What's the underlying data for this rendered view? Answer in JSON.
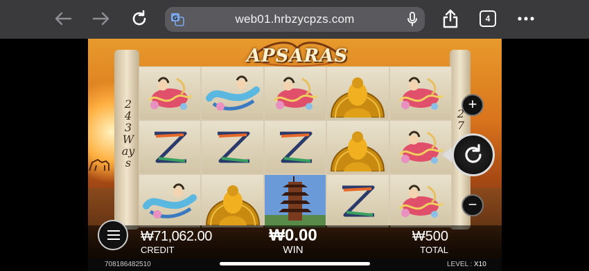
{
  "browser": {
    "url": "web01.hrbzycpzs.com",
    "tab_count": "4",
    "colors": {
      "toolbar": "#3a3a3c",
      "address_bar": "#5a5a5e",
      "icon": "#ffffff",
      "icon_disabled": "#8e8e93"
    }
  },
  "game": {
    "logo": "APSARAS",
    "ways_text": "243 Ways",
    "symbols": [
      [
        "apsara",
        "z-symbol",
        "apsara-2"
      ],
      [
        "apsara-2",
        "z-symbol",
        "buddha"
      ],
      [
        "apsara",
        "z-symbol",
        "pagoda"
      ],
      [
        "buddha",
        "buddha",
        "z-symbol"
      ],
      [
        "apsara",
        "apsara",
        "apsara"
      ]
    ],
    "credit": {
      "value": "₩71,062.00",
      "label": "CREDIT"
    },
    "win": {
      "value": "₩0.00",
      "label": "WIN"
    },
    "total": {
      "value": "₩500",
      "label": "TOTAL"
    },
    "session_id": "708186482510",
    "level": {
      "label": "LEVEL :",
      "value": "X10"
    }
  }
}
